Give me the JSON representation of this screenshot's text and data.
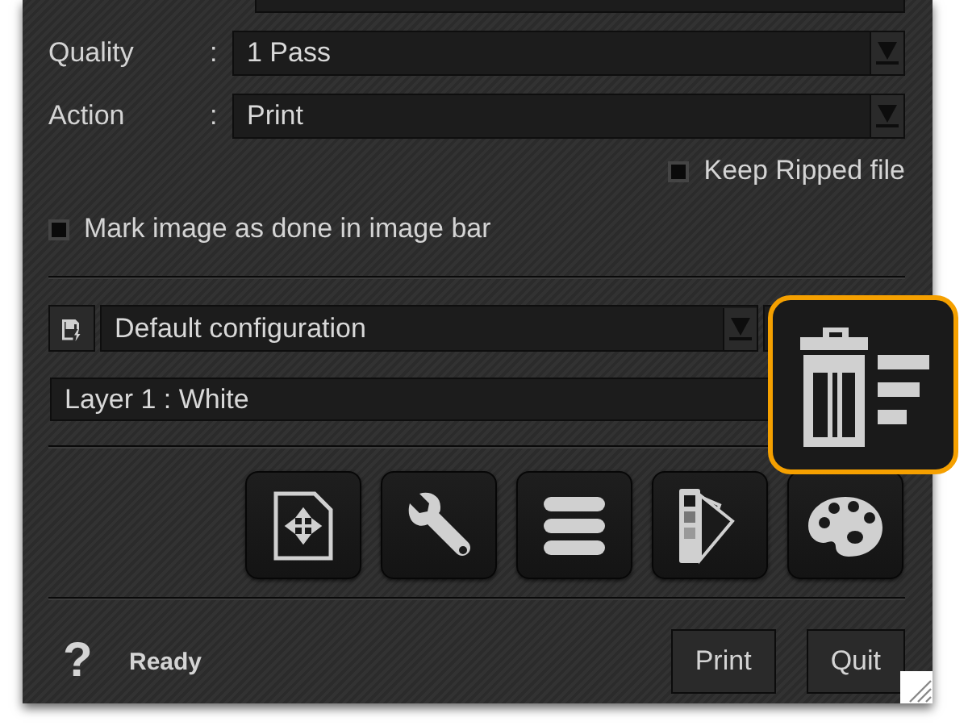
{
  "settings": [
    {
      "label": "Quality",
      "colon": ":",
      "value": "1 Pass"
    },
    {
      "label": "Action",
      "colon": ":",
      "value": "Print"
    }
  ],
  "keep_ripped_file": {
    "label": "Keep Ripped file",
    "checked": false
  },
  "mark_done": {
    "label": "Mark image as done in image bar",
    "checked": false
  },
  "configuration": {
    "value": "Default configuration"
  },
  "layer": {
    "value": "Layer 1 : White"
  },
  "status_bar": {
    "help": "?",
    "status": "Ready"
  },
  "buttons": [
    "Print",
    "Quit"
  ]
}
